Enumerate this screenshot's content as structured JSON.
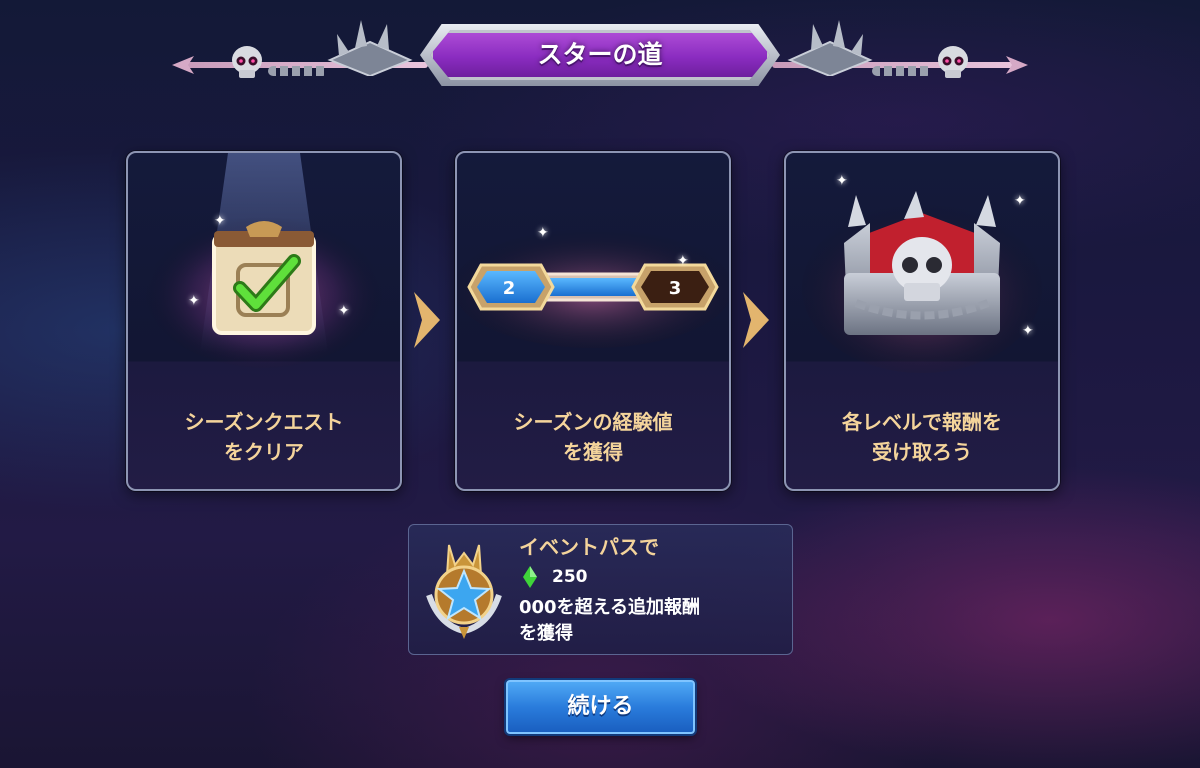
{
  "header": {
    "title": "スターの道"
  },
  "steps": [
    {
      "label_line1": "シーズンクエスト",
      "label_line2": "をクリア",
      "icon": "quest-checklist-icon"
    },
    {
      "label_line1": "シーズンの経験値",
      "label_line2": "を獲得",
      "icon": "level-progress-bar-icon",
      "level_from": "2",
      "level_to": "3",
      "progress": 0.72
    },
    {
      "label_line1": "各レベルで報酬を",
      "label_line2": "受け取ろう",
      "icon": "skull-chest-icon"
    }
  ],
  "event_pass": {
    "title": "イベントパスで",
    "gem_amount": "250",
    "desc_line1": "000を超える追加報酬",
    "desc_line2": "を獲得",
    "icon": "star-emblem-icon"
  },
  "continue_button": {
    "label": "続ける"
  },
  "colors": {
    "accent_gold": "#f4d49b",
    "banner_purple": "#8a2cc0",
    "button_blue": "#2a7cdc",
    "gem_green": "#3fd43a"
  }
}
